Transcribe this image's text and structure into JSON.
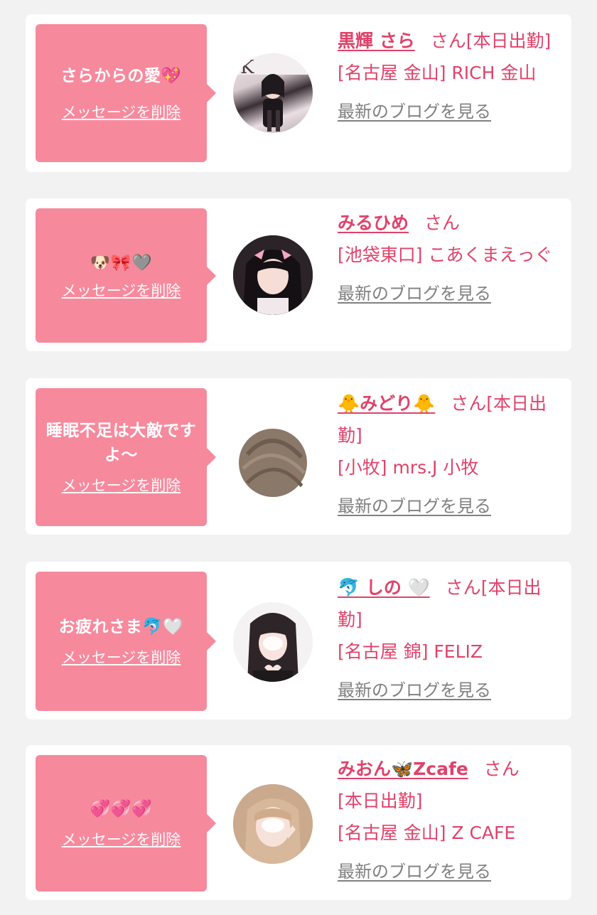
{
  "colors": {
    "accent": "#e0426a",
    "bubble": "#f7899d",
    "card": "#ffffff",
    "background": "#f2f2f2",
    "link_gray": "#808080"
  },
  "cards": [
    {
      "message": "さらからの愛💖",
      "delete_label": "メッセージを削除",
      "name": "黒輝 さら",
      "san": "さん",
      "status": "[本日出勤]",
      "shop": "[名古屋 金山] RICH 金山",
      "blog_label": "最新のブログを見る",
      "avatar_icon": "avatar-photo"
    },
    {
      "message": "🐶🎀🩶",
      "delete_label": "メッセージを削除",
      "name": "みるひめ",
      "san": "さん",
      "status": "",
      "shop": "[池袋東口] こあくまえっぐ",
      "blog_label": "最新のブログを見る",
      "avatar_icon": "avatar-photo"
    },
    {
      "message": "睡眠不足は大敵ですよ〜",
      "delete_label": "メッセージを削除",
      "name": "🐥みどり🐥",
      "san": "さん",
      "status": "[本日出勤]",
      "shop": "[小牧] mrs.J 小牧",
      "blog_label": "最新のブログを見る",
      "avatar_icon": "avatar-photo"
    },
    {
      "message": "お疲れさま🐬🤍",
      "delete_label": "メッセージを削除",
      "name": "🐬 しの 🤍",
      "san": "さん",
      "status": "[本日出勤]",
      "shop": "[名古屋 錦] FELIZ",
      "blog_label": "最新のブログを見る",
      "avatar_icon": "avatar-photo"
    },
    {
      "message": "💞💞💞",
      "delete_label": "メッセージを削除",
      "name": "みおん🦋Zcafe",
      "san": "さん",
      "status": "[本日出勤]",
      "shop": "[名古屋 金山] Z CAFE",
      "blog_label": "最新のブログを見る",
      "avatar_icon": "avatar-photo"
    }
  ]
}
